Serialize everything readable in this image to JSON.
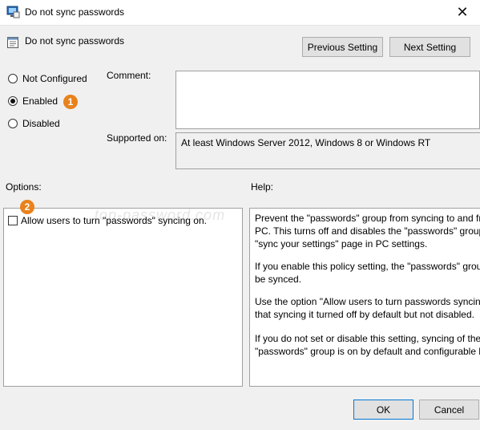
{
  "window": {
    "title": "Do not sync passwords"
  },
  "header": {
    "policy_name": "Do not sync passwords",
    "prev_label": "Previous Setting",
    "next_label": "Next Setting"
  },
  "state": {
    "options": [
      "Not Configured",
      "Enabled",
      "Disabled"
    ],
    "selected": "Enabled"
  },
  "annotations": {
    "badge1": "1",
    "badge2": "2"
  },
  "comment": {
    "label": "Comment:",
    "value": ""
  },
  "supported": {
    "label": "Supported on:",
    "value": "At least Windows Server 2012, Windows 8 or Windows RT"
  },
  "options": {
    "label": "Options:",
    "checkbox_label": "Allow users to turn \"passwords\" syncing on.",
    "checked": false
  },
  "watermark": "top-password.com",
  "help": {
    "label": "Help:",
    "paragraphs": [
      [
        "Prevent the \"passwords\" group from syncing to and fr",
        "PC.  This turns off and disables the \"passwords\" group",
        "\"sync your settings\" page in PC settings."
      ],
      [
        "If you enable this policy setting, the \"passwords\" grou",
        "be synced."
      ],
      [
        "Use the option \"Allow users to turn passwords syncing",
        "that syncing it turned off by default but not disabled."
      ],
      [
        "If you do not set or disable this setting, syncing of the",
        "\"passwords\" group is on by default and configurable b"
      ]
    ]
  },
  "footer": {
    "ok_label": "OK",
    "cancel_label": "Cancel"
  }
}
